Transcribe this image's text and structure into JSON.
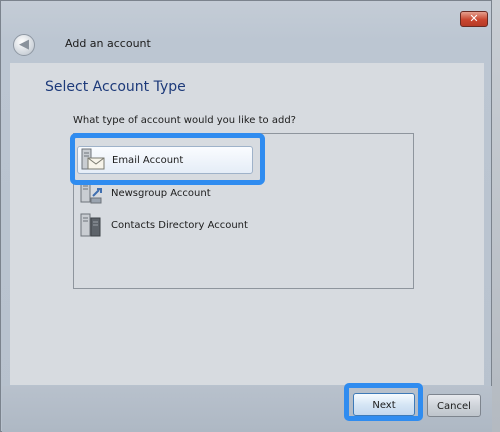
{
  "window": {
    "title": "Add an account",
    "close_symbol": "✕"
  },
  "header": {
    "back_symbol": "◀",
    "title": "Add an account"
  },
  "page": {
    "heading": "Select Account Type",
    "question": "What type of account would you like to add?"
  },
  "account_types": [
    {
      "label": "Email Account",
      "icon": "email-server-icon",
      "selected": true
    },
    {
      "label": "Newsgroup Account",
      "icon": "newsgroup-server-icon",
      "selected": false
    },
    {
      "label": "Contacts Directory Account",
      "icon": "directory-server-icon",
      "selected": false
    }
  ],
  "footer": {
    "next_label": "Next",
    "cancel_label": "Cancel"
  },
  "colors": {
    "highlight": "#2f8cf0",
    "heading": "#1d3a7a"
  }
}
